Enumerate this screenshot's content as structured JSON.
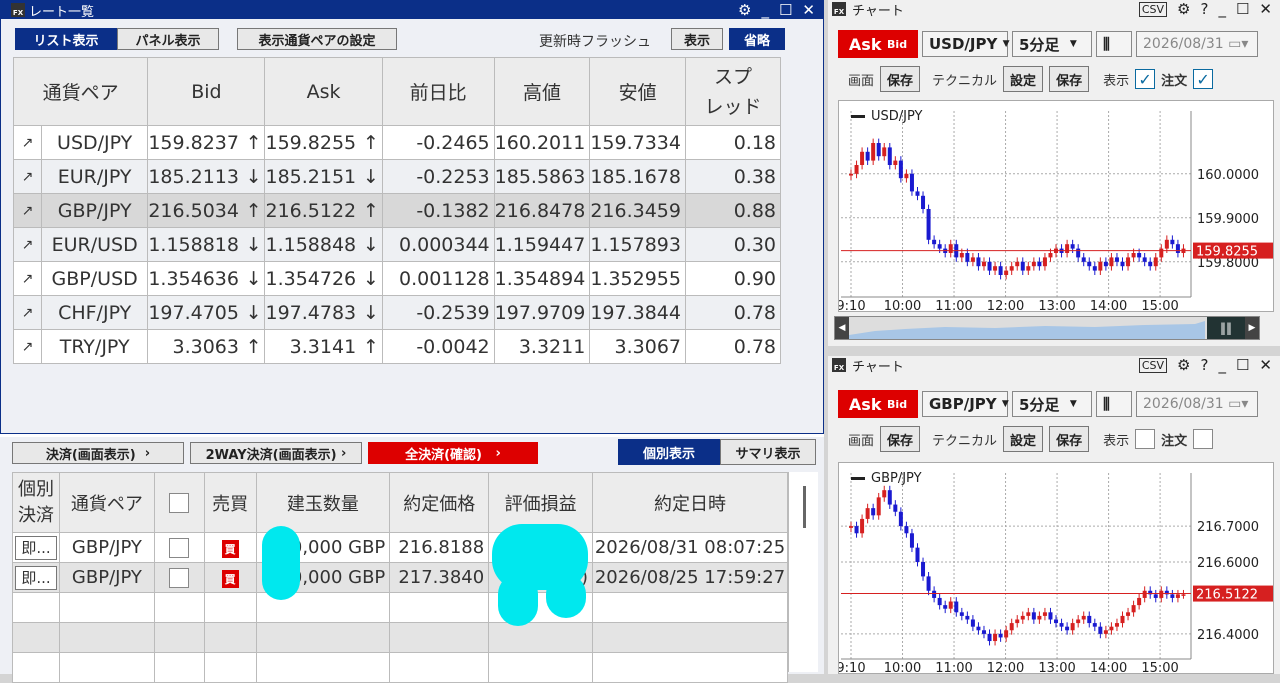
{
  "rate_window": {
    "title": "レート一覧",
    "tabs": {
      "list": "リスト表示",
      "panel": "パネル表示"
    },
    "settings_btn": "表示通貨ペアの設定",
    "flash_label": "更新時フラッシュ",
    "show_btn": "表示",
    "omit_btn": "省略",
    "headers": {
      "pair": "通貨ペア",
      "bid": "Bid",
      "ask": "Ask",
      "change": "前日比",
      "high": "高値",
      "low": "安値",
      "spread1": "スプ",
      "spread2": "レッド"
    },
    "rows": [
      {
        "pair": "USD/JPY",
        "bid": "159.8237",
        "bid_dir": "↑",
        "ask": "159.8255",
        "ask_dir": "↑",
        "change": "-0.2465",
        "high": "160.2011",
        "low": "159.7334",
        "spread": "0.18"
      },
      {
        "pair": "EUR/JPY",
        "bid": "185.2113",
        "bid_dir": "↓",
        "ask": "185.2151",
        "ask_dir": "↓",
        "change": "-0.2253",
        "high": "185.5863",
        "low": "185.1678",
        "spread": "0.38"
      },
      {
        "pair": "GBP/JPY",
        "bid": "216.5034",
        "bid_dir": "↑",
        "ask": "216.5122",
        "ask_dir": "↑",
        "change": "-0.1382",
        "high": "216.8478",
        "low": "216.3459",
        "spread": "0.88"
      },
      {
        "pair": "EUR/USD",
        "bid": "1.158818",
        "bid_dir": "↓",
        "ask": "1.158848",
        "ask_dir": "↓",
        "change": "0.000344",
        "high": "1.159447",
        "low": "1.157893",
        "spread": "0.30"
      },
      {
        "pair": "GBP/USD",
        "bid": "1.354636",
        "bid_dir": "↓",
        "ask": "1.354726",
        "ask_dir": "↓",
        "change": "0.001128",
        "high": "1.354894",
        "low": "1.352955",
        "spread": "0.90"
      },
      {
        "pair": "CHF/JPY",
        "bid": "197.4705",
        "bid_dir": "↓",
        "ask": "197.4783",
        "ask_dir": "↓",
        "change": "-0.2539",
        "high": "197.9709",
        "low": "197.3844",
        "spread": "0.78"
      },
      {
        "pair": "TRY/JPY",
        "bid": "3.3063",
        "bid_dir": "↑",
        "ask": "3.3141",
        "ask_dir": "↑",
        "change": "-0.0042",
        "high": "3.3211",
        "low": "3.3067",
        "spread": "0.78"
      }
    ]
  },
  "positions": {
    "btn_settle": "決済(画面表示)",
    "btn_2way": "2WAY決済(画面表示)",
    "btn_all": "全決済(確認)",
    "btn_individual": "個別表示",
    "btn_summary": "サマリ表示",
    "headers": {
      "ind1": "個別",
      "ind2": "決済",
      "pair": "通貨ペア",
      "side": "売買",
      "qty": "建玉数量",
      "price": "約定価格",
      "pnl": "評価損益",
      "date": "約定日時"
    },
    "rows": [
      {
        "btn": "即...",
        "pair": "GBP/JPY",
        "side": "買",
        "qty": "0,000 GBP",
        "price": "216.8188",
        "pnl": "",
        "date": "2026/08/31 08:07:25"
      },
      {
        "btn": "即...",
        "pair": "GBP/JPY",
        "side": "買",
        "qty": "0,000 GBP",
        "price": "217.3840",
        "pnl": ")",
        "date": "2026/08/25 17:59:27"
      }
    ]
  },
  "chart1": {
    "title": "チャート",
    "ask_label": "Ask",
    "bid_label": "Bid",
    "pair": "USD/JPY",
    "timeframe": "5分足",
    "date": "2026/08/31",
    "draw_label": "画面",
    "save1": "保存",
    "tech_label": "テクニカル",
    "settings": "設定",
    "save2": "保存",
    "display_label": "表示",
    "order_label": "注文",
    "legend": "USD/JPY",
    "price_line_label": "159.8255",
    "colors": {
      "up": "#d62020",
      "down": "#1a1ad0",
      "price_line": "#d62020"
    }
  },
  "chart2": {
    "title": "チャート",
    "ask_label": "Ask",
    "bid_label": "Bid",
    "pair": "GBP/JPY",
    "timeframe": "5分足",
    "date": "2026/08/31",
    "draw_label": "画面",
    "save1": "保存",
    "tech_label": "テクニカル",
    "settings": "設定",
    "save2": "保存",
    "display_label": "表示",
    "order_label": "注文",
    "legend": "GBP/JPY",
    "price_line_label": "216.5122"
  },
  "chart_data": [
    {
      "type": "candlestick",
      "title": "",
      "legend": [
        "USD/JPY"
      ],
      "x_ticks": [
        "9:10",
        "10:00",
        "11:00",
        "12:00",
        "13:00",
        "14:00",
        "15:00"
      ],
      "y_ticks": [
        159.8,
        159.9,
        160.0
      ],
      "y_tick_labels": [
        "159.8000",
        "159.9000",
        "160.0000"
      ],
      "ylim": [
        159.72,
        160.12
      ],
      "current_price": 159.8255,
      "grid": true,
      "close": [
        160.0,
        160.02,
        160.05,
        160.03,
        160.07,
        160.04,
        160.06,
        160.02,
        160.03,
        159.99,
        160.0,
        159.96,
        159.95,
        159.92,
        159.85,
        159.84,
        159.83,
        159.82,
        159.84,
        159.81,
        159.82,
        159.8,
        159.81,
        159.79,
        159.8,
        159.78,
        159.79,
        159.77,
        159.78,
        159.79,
        159.8,
        159.78,
        159.79,
        159.8,
        159.79,
        159.81,
        159.82,
        159.83,
        159.82,
        159.84,
        159.83,
        159.81,
        159.8,
        159.79,
        159.78,
        159.8,
        159.79,
        159.81,
        159.8,
        159.79,
        159.81,
        159.82,
        159.81,
        159.8,
        159.79,
        159.81,
        159.83,
        159.85,
        159.84,
        159.82,
        159.83
      ]
    },
    {
      "type": "candlestick",
      "title": "",
      "legend": [
        "GBP/JPY"
      ],
      "x_ticks": [
        "9:10",
        "10:00",
        "11:00",
        "12:00",
        "13:00",
        "14:00",
        "15:00"
      ],
      "y_ticks": [
        216.4,
        216.6,
        216.7
      ],
      "y_tick_labels": [
        "216.4000",
        "216.6000",
        "216.7000"
      ],
      "ylim": [
        216.33,
        216.82
      ],
      "current_price": 216.5122,
      "grid": true,
      "close": [
        216.7,
        216.68,
        216.72,
        216.75,
        216.73,
        216.78,
        216.8,
        216.76,
        216.74,
        216.7,
        216.68,
        216.64,
        216.6,
        216.56,
        216.52,
        216.5,
        216.48,
        216.47,
        216.49,
        216.46,
        216.45,
        216.44,
        216.42,
        216.41,
        216.4,
        216.38,
        216.4,
        216.39,
        216.41,
        216.43,
        216.44,
        216.45,
        216.46,
        216.44,
        216.45,
        216.46,
        216.44,
        216.43,
        216.42,
        216.41,
        216.43,
        216.44,
        216.45,
        216.43,
        216.42,
        216.4,
        216.41,
        216.42,
        216.43,
        216.45,
        216.46,
        216.48,
        216.5,
        216.52,
        216.51,
        216.5,
        216.52,
        216.51,
        216.5,
        216.51,
        216.51
      ]
    }
  ]
}
